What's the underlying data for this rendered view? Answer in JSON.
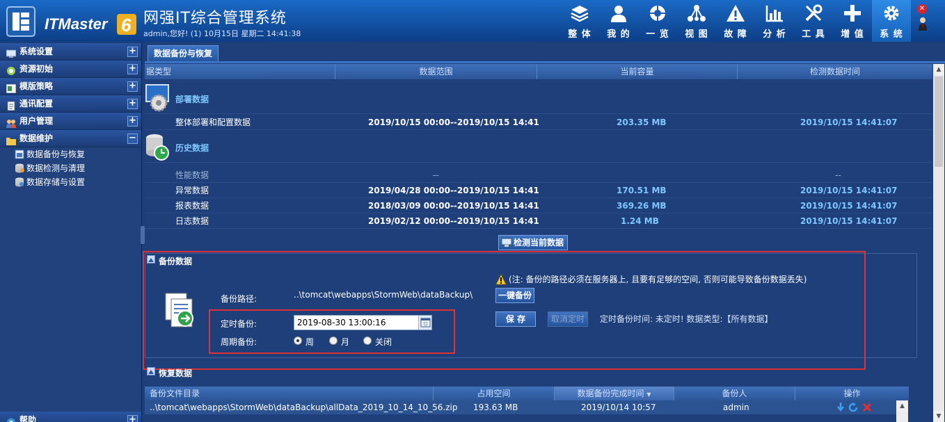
{
  "header": {
    "title": "网强IT综合管理系统",
    "welcome": "admin,您好! (1) 10月15日 星期二 14:41:38",
    "logo_text": "ITMaster 6"
  },
  "nav": [
    {
      "label": "整 体",
      "icon": "layers-icon"
    },
    {
      "label": "我 的",
      "icon": "user-icon"
    },
    {
      "label": "一 览",
      "icon": "globe-icon"
    },
    {
      "label": "视 图",
      "icon": "topology-icon"
    },
    {
      "label": "故 障",
      "icon": "warning-icon"
    },
    {
      "label": "分 析",
      "icon": "chart-icon"
    },
    {
      "label": "工 具",
      "icon": "tools-icon"
    },
    {
      "label": "增 值",
      "icon": "plus-icon"
    },
    {
      "label": "系 统",
      "icon": "gear-icon",
      "active": true
    }
  ],
  "sidebar": {
    "items": [
      {
        "label": "系统设置",
        "toggle": "+"
      },
      {
        "label": "资源初始",
        "toggle": "+"
      },
      {
        "label": "模版策略",
        "toggle": "+"
      },
      {
        "label": "通讯配置",
        "toggle": "+"
      },
      {
        "label": "用户管理",
        "toggle": "+"
      },
      {
        "label": "数据维护",
        "toggle": "−"
      }
    ],
    "subitems": [
      "数据备份与恢复",
      "数据检测与清理",
      "数据存储与设置"
    ],
    "bottom": {
      "label": "帮助",
      "toggle": "+"
    }
  },
  "tab": {
    "label": "数据备份与恢复"
  },
  "data_grid": {
    "columns": [
      "据类型",
      "数据范围",
      "当前容量",
      "检测数据时间"
    ],
    "groups": [
      {
        "label": "部署数据"
      },
      {
        "label": "历史数据"
      }
    ],
    "rows": [
      {
        "name": "整体部署和配置数据",
        "range": "2019/10/15 00:00--2019/10/15 14:41",
        "size": "203.35 MB",
        "time": "2019/10/15 14:41:07"
      },
      {
        "name": "性能数据",
        "range": "--",
        "size": "",
        "time": "--"
      },
      {
        "name": "异常数据",
        "range": "2019/04/28 00:00--2019/10/15 14:41",
        "size": "170.51 MB",
        "time": "2019/10/15 14:41:07"
      },
      {
        "name": "报表数据",
        "range": "2018/03/09 00:00--2019/10/15 14:41",
        "size": "369.26 MB",
        "time": "2019/10/15 14:41:07"
      },
      {
        "name": "日志数据",
        "range": "2019/02/12 00:00--2019/10/15 14:41",
        "size": "1.24 MB",
        "time": "2019/10/15 14:41:07"
      }
    ]
  },
  "check_button": "检测当前数据",
  "backup": {
    "title": "备份数据",
    "path_label": "备份路径:",
    "path_value": "..\\tomcat\\webapps\\StormWeb\\dataBackup\\",
    "note": "(注: 备份的路径必须在服务器上, 且要有足够的空间, 否则可能导致备份数据丢失)",
    "one_click": "一键备份",
    "timed_label": "定时备份:",
    "timed_value": "2019-08-30 13:00:16",
    "period_label": "周期备份:",
    "period_options": [
      "周",
      "月",
      "关闭"
    ],
    "period_selected": "周",
    "save": "保 存",
    "cancel_timed": "取消定时",
    "timed_status": "定时备份时间: 未定时! 数据类型:【所有数据】"
  },
  "restore": {
    "title": "恢复数据",
    "columns": [
      "备份文件目录",
      "占用空间",
      "数据备份完成时间",
      "备份人",
      "操作"
    ],
    "rows": [
      {
        "file": "..\\tomcat\\webapps\\StormWeb\\dataBackup\\allData_2019_10_14_10_56.zip",
        "size": "193.63 MB",
        "time": "2019/10/14 10:57",
        "user": "admin"
      }
    ]
  },
  "colors": {
    "highlight": "#e03137",
    "accent_value": "#7fc7ff",
    "header_bg": "#0d3e87"
  }
}
